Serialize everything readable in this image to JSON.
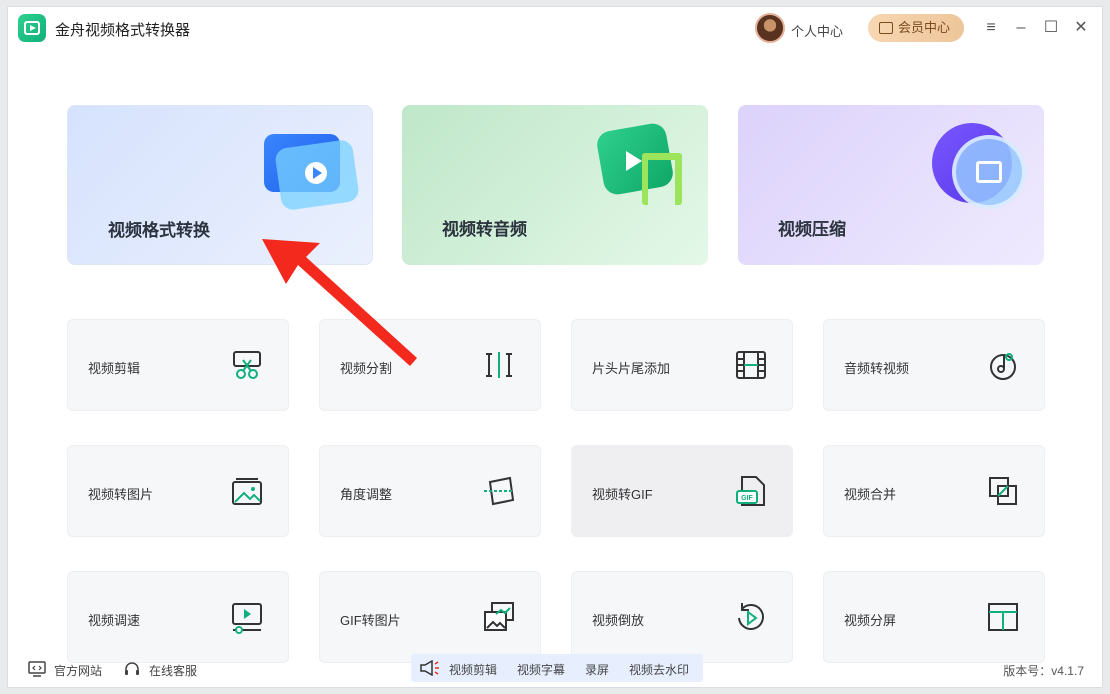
{
  "app": {
    "title": "金舟视频格式转换器"
  },
  "header": {
    "user_center": "个人中心",
    "vip_center": "会员中心"
  },
  "feature_cards": [
    {
      "label": "视频格式转换"
    },
    {
      "label": "视频转音频"
    },
    {
      "label": "视频压缩"
    }
  ],
  "tools": [
    {
      "label": "视频剪辑",
      "icon": "scissors-icon"
    },
    {
      "label": "视频分割",
      "icon": "split-icon"
    },
    {
      "label": "片头片尾添加",
      "icon": "film-icon"
    },
    {
      "label": "音频转视频",
      "icon": "music-disc-icon"
    },
    {
      "label": "视频转图片",
      "icon": "image-icon"
    },
    {
      "label": "角度调整",
      "icon": "rotate-frame-icon"
    },
    {
      "label": "视频转GIF",
      "icon": "gif-file-icon"
    },
    {
      "label": "视频合并",
      "icon": "merge-icon"
    },
    {
      "label": "视频调速",
      "icon": "speed-icon"
    },
    {
      "label": "GIF转图片",
      "icon": "gif-image-icon"
    },
    {
      "label": "视频倒放",
      "icon": "reverse-icon"
    },
    {
      "label": "视频分屏",
      "icon": "split-screen-icon"
    }
  ],
  "footer": {
    "official_site": "官方网站",
    "online_support": "在线客服",
    "promo_items": [
      "视频剪辑",
      "视频字幕",
      "录屏",
      "视频去水印"
    ],
    "version": "版本号：v4.1.7"
  },
  "colors": {
    "accent_green": "#11b07a",
    "arrow_red": "#f2291c",
    "vip_gold": "#eec59a"
  }
}
